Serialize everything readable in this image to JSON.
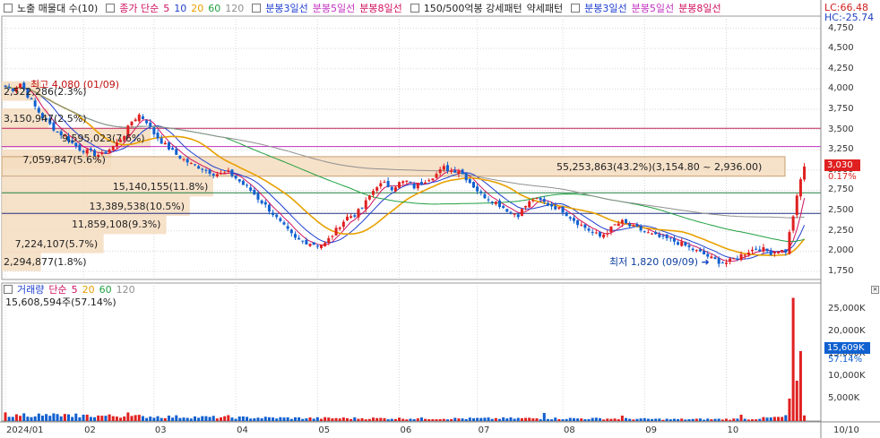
{
  "legend": {
    "title": "노출 매물대 수(10)",
    "ma_label": "종가 단순",
    "ma_periods": [
      "5",
      "10",
      "20",
      "60",
      "120"
    ],
    "ma_colors": [
      "#d01060",
      "#2040d0",
      "#e8a000",
      "#20a040",
      "#909090"
    ],
    "bunbong1": "분봉3일선",
    "bunbong2": "분봉5일선",
    "bunbong3": "분봉8일선",
    "strong": "150/500억봉 강세패턴",
    "weak": "약세패턴",
    "bunbong4": "분봉3일선",
    "bunbong5": "분봉5일선",
    "bunbong6": "분봉8일선"
  },
  "top_right": {
    "lc": "LC:66.48",
    "hc": "HC:-25.74"
  },
  "price_axis": [
    "4,750",
    "4,500",
    "4,250",
    "4,000",
    "3,750",
    "3,500",
    "3,250",
    "3,000",
    "2,750",
    "2,500",
    "2,250",
    "2,000",
    "1,750"
  ],
  "price_tag": {
    "value": "3,030",
    "pct": "0.17%"
  },
  "high_label": "최고 4,080 (01/09)",
  "low_label": "최저 1,820 (09/09)",
  "profile_labels": [
    {
      "text": "2,522,286(2.3%)",
      "price": 3975,
      "width": 0.05
    },
    {
      "text": "3,150,947(2.5%)",
      "price": 3640,
      "width": 0.06
    },
    {
      "text": "9,595,023(7.6%)",
      "price": 3395,
      "width": 0.19
    },
    {
      "text": "7,059,847(5.6%)",
      "price": 3135,
      "width": 0.14
    },
    {
      "text": "55,253,863(43.2%)(3,154.80 ~ 2,936.00)",
      "price": 3045,
      "width": 1.0
    },
    {
      "text": "15,140,155(11.8%)",
      "price": 2795,
      "width": 0.27
    },
    {
      "text": "13,389,538(10.5%)",
      "price": 2555,
      "width": 0.24
    },
    {
      "text": "11,859,108(9.3%)",
      "price": 2330,
      "width": 0.21
    },
    {
      "text": "7,224,107(5.7%)",
      "price": 2095,
      "width": 0.13
    },
    {
      "text": "2,294,877(1.8%)",
      "price": 1875,
      "width": 0.05
    }
  ],
  "hlines": [
    {
      "price": 3515,
      "color": "#c0205a"
    },
    {
      "price": 3290,
      "color": "#c030c0"
    },
    {
      "price": 2720,
      "color": "#208040"
    },
    {
      "price": 2465,
      "color": "#203080"
    }
  ],
  "volume_legend": {
    "title": "거래량",
    "ma_label": "단순",
    "periods": [
      "5",
      "20",
      "60",
      "120"
    ],
    "colors": [
      "#d01060",
      "#e8a000",
      "#20a040",
      "#909090"
    ],
    "info": "15,608,594주(57.14%)"
  },
  "volume_axis": [
    "25,000K",
    "20,000K",
    "15,000K",
    "10,000K",
    "5,000K"
  ],
  "volume_tag": {
    "value": "15,609K",
    "pct": "57.14%"
  },
  "months": [
    "2024/01",
    "02",
    "03",
    "04",
    "05",
    "06",
    "07",
    "08",
    "09",
    "10"
  ],
  "right_date": "10/10",
  "colors": {
    "up": "#e02020",
    "down": "#1060d0",
    "band": "#f4dcc0",
    "bandBorder": "#c8a070",
    "grid": "#d8d8d8"
  },
  "chart_data": {
    "type": "candlestick",
    "price_range": [
      1650,
      4900
    ],
    "volume_range": [
      0,
      28000
    ],
    "anchors": [
      [
        0,
        4030
      ],
      [
        2,
        4000
      ],
      [
        4,
        4070
      ],
      [
        6,
        3920
      ],
      [
        8,
        3780
      ],
      [
        10,
        3650
      ],
      [
        12,
        3560
      ],
      [
        14,
        3470
      ],
      [
        16,
        3420
      ],
      [
        18,
        3330
      ],
      [
        20,
        3260
      ],
      [
        22,
        3230
      ],
      [
        24,
        3200
      ],
      [
        26,
        3180
      ],
      [
        28,
        3260
      ],
      [
        30,
        3330
      ],
      [
        32,
        3440
      ],
      [
        34,
        3600
      ],
      [
        36,
        3680
      ],
      [
        38,
        3600
      ],
      [
        40,
        3450
      ],
      [
        42,
        3350
      ],
      [
        44,
        3270
      ],
      [
        46,
        3190
      ],
      [
        48,
        3130
      ],
      [
        50,
        3070
      ],
      [
        52,
        3040
      ],
      [
        54,
        3000
      ],
      [
        56,
        2960
      ],
      [
        58,
        2950
      ],
      [
        60,
        2970
      ],
      [
        62,
        2900
      ],
      [
        64,
        2820
      ],
      [
        66,
        2750
      ],
      [
        68,
        2650
      ],
      [
        70,
        2560
      ],
      [
        72,
        2460
      ],
      [
        74,
        2350
      ],
      [
        76,
        2250
      ],
      [
        78,
        2150
      ],
      [
        80,
        2120
      ],
      [
        82,
        2100
      ],
      [
        84,
        2070
      ],
      [
        86,
        2090
      ],
      [
        88,
        2200
      ],
      [
        90,
        2320
      ],
      [
        92,
        2420
      ],
      [
        94,
        2450
      ],
      [
        96,
        2530
      ],
      [
        98,
        2680
      ],
      [
        100,
        2810
      ],
      [
        102,
        2830
      ],
      [
        104,
        2780
      ],
      [
        106,
        2840
      ],
      [
        108,
        2860
      ],
      [
        110,
        2790
      ],
      [
        112,
        2850
      ],
      [
        114,
        2900
      ],
      [
        116,
        2950
      ],
      [
        118,
        3030
      ],
      [
        120,
        2990
      ],
      [
        122,
        3000
      ],
      [
        124,
        2900
      ],
      [
        126,
        2800
      ],
      [
        128,
        2700
      ],
      [
        130,
        2650
      ],
      [
        132,
        2600
      ],
      [
        134,
        2540
      ],
      [
        136,
        2480
      ],
      [
        138,
        2450
      ],
      [
        140,
        2560
      ],
      [
        142,
        2640
      ],
      [
        144,
        2620
      ],
      [
        146,
        2580
      ],
      [
        148,
        2540
      ],
      [
        150,
        2500
      ],
      [
        152,
        2420
      ],
      [
        154,
        2350
      ],
      [
        156,
        2290
      ],
      [
        158,
        2230
      ],
      [
        160,
        2180
      ],
      [
        162,
        2240
      ],
      [
        164,
        2320
      ],
      [
        166,
        2360
      ],
      [
        168,
        2310
      ],
      [
        170,
        2280
      ],
      [
        172,
        2240
      ],
      [
        174,
        2200
      ],
      [
        176,
        2170
      ],
      [
        178,
        2150
      ],
      [
        180,
        2120
      ],
      [
        182,
        2090
      ],
      [
        184,
        2040
      ],
      [
        186,
        2000
      ],
      [
        188,
        1960
      ],
      [
        190,
        1910
      ],
      [
        192,
        1870
      ],
      [
        194,
        1860
      ],
      [
        196,
        1900
      ],
      [
        198,
        1950
      ],
      [
        200,
        2000
      ],
      [
        202,
        2030
      ],
      [
        204,
        2020
      ],
      [
        206,
        1980
      ],
      [
        208,
        2010
      ],
      [
        210,
        2000
      ],
      [
        212,
        2440
      ],
      [
        214,
        2880
      ],
      [
        215,
        3050
      ]
    ],
    "volumes": [
      [
        0,
        1500
      ],
      [
        20,
        1200
      ],
      [
        40,
        1000
      ],
      [
        60,
        800
      ],
      [
        80,
        650
      ],
      [
        100,
        600
      ],
      [
        120,
        550
      ],
      [
        140,
        600
      ],
      [
        160,
        550
      ],
      [
        180,
        400
      ],
      [
        200,
        450
      ],
      [
        210,
        900
      ]
    ],
    "volume_spikes": [
      [
        3,
        1500
      ],
      [
        10,
        1200
      ],
      [
        18,
        900
      ],
      [
        33,
        1900
      ],
      [
        37,
        1100
      ],
      [
        60,
        1300
      ],
      [
        145,
        1800
      ],
      [
        166,
        1200
      ],
      [
        198,
        1400
      ],
      [
        210,
        1300
      ],
      [
        211,
        5000
      ],
      [
        212,
        27500
      ],
      [
        213,
        9000
      ],
      [
        214,
        15609
      ]
    ]
  }
}
